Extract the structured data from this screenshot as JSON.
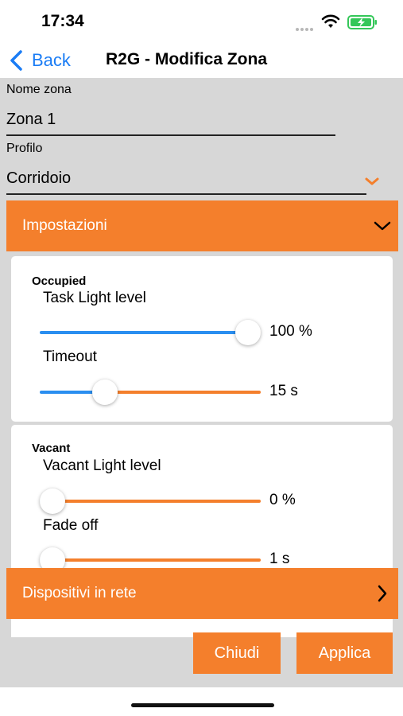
{
  "status_bar": {
    "time": "17:34",
    "icons": [
      "signal-dots-icon",
      "wifi-icon",
      "battery-charging-icon"
    ],
    "battery_color": "#34c759"
  },
  "nav": {
    "back_label": "Back",
    "title": "R2G - Modifica Zona"
  },
  "form": {
    "zone_name_label": "Nome zona",
    "zone_name_value": "Zona 1",
    "profile_label": "Profilo",
    "profile_value": "Corridoio"
  },
  "settings_section": {
    "title": "Impostazioni",
    "expanded": true,
    "occupied": {
      "title": "Occupied",
      "task_light_label": "Task Light level",
      "task_light_value": "100 %",
      "task_light_fraction": 1.0,
      "timeout_label": "Timeout",
      "timeout_value": "15 s",
      "timeout_fraction": 0.27
    },
    "vacant": {
      "title": "Vacant",
      "vacant_light_label": "Vacant Light level",
      "vacant_light_value": "0 %",
      "vacant_light_fraction": 0.0,
      "fade_off_label": "Fade off",
      "fade_off_value": "1 s",
      "fade_off_fraction": 0.0
    }
  },
  "devices_section": {
    "title": "Dispositivi in rete"
  },
  "buttons": {
    "close": "Chiudi",
    "apply": "Applica"
  },
  "colors": {
    "accent": "#f47f2c",
    "link": "#1a7cf5",
    "slider_active": "#2a8ef0",
    "background": "#d7d7d7"
  }
}
